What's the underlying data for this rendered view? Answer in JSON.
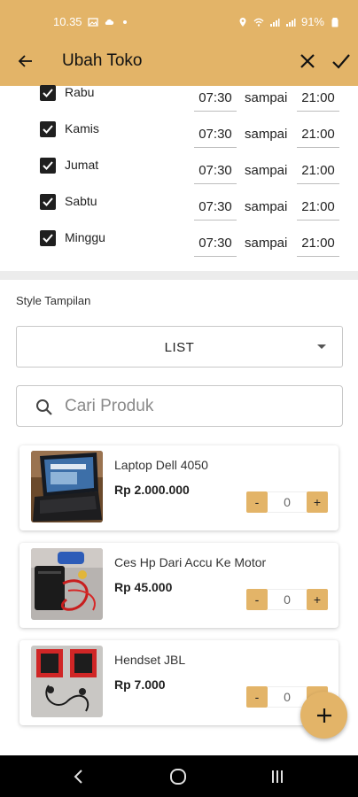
{
  "status_bar": {
    "time": "10.35",
    "battery": "91%",
    "icons": [
      "gallery-icon",
      "cloud-icon",
      "dot-icon",
      "location-icon",
      "wifi-icon",
      "signal-icon",
      "signal-icon",
      "battery-icon"
    ]
  },
  "app_bar": {
    "title": "Ubah Toko",
    "back_icon": "arrow-left-icon",
    "close_icon": "close-icon",
    "save_icon": "check-icon"
  },
  "schedule": {
    "until_label": "sampai",
    "days": [
      {
        "name": "Rabu",
        "checked": true,
        "from": "07:30",
        "to": "21:00"
      },
      {
        "name": "Kamis",
        "checked": true,
        "from": "07:30",
        "to": "21:00"
      },
      {
        "name": "Jumat",
        "checked": true,
        "from": "07:30",
        "to": "21:00"
      },
      {
        "name": "Sabtu",
        "checked": true,
        "from": "07:30",
        "to": "21:00"
      },
      {
        "name": "Minggu",
        "checked": true,
        "from": "07:30",
        "to": "21:00"
      }
    ]
  },
  "display_style": {
    "label": "Style Tampilan",
    "selected": "LIST"
  },
  "search": {
    "placeholder": "Cari Produk",
    "value": ""
  },
  "products": [
    {
      "name": "Laptop Dell 4050",
      "price": "Rp 2.000.000",
      "qty": "0",
      "minus": "-",
      "plus": "+"
    },
    {
      "name": "Ces Hp Dari Accu Ke Motor",
      "price": "Rp 45.000",
      "qty": "0",
      "minus": "-",
      "plus": "+"
    },
    {
      "name": "Hendset JBL",
      "price": "Rp 7.000",
      "qty": "0",
      "minus": "-",
      "plus": "+"
    }
  ],
  "fab": {
    "icon": "plus-icon"
  },
  "nav_bar": {
    "icons": [
      "back-nav-icon",
      "home-nav-icon",
      "recents-nav-icon"
    ]
  },
  "colors": {
    "accent": "#e3b468",
    "checkbox": "#1f1f1f",
    "navbar": "#000000"
  }
}
